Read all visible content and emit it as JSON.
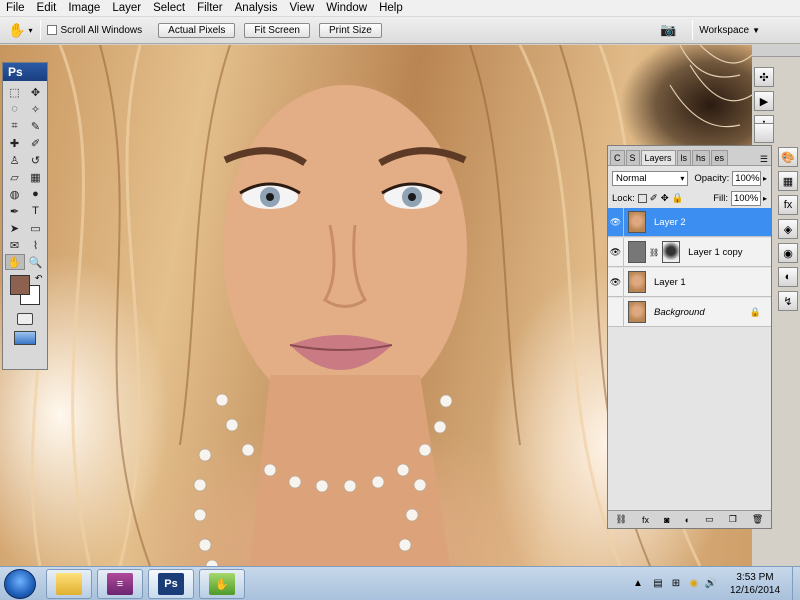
{
  "menu": [
    "File",
    "Edit",
    "Image",
    "Layer",
    "Select",
    "Filter",
    "Analysis",
    "View",
    "Window",
    "Help"
  ],
  "options": {
    "scroll_all": "Scroll All Windows",
    "actual_pixels": "Actual Pixels",
    "fit_screen": "Fit Screen",
    "print_size": "Print Size",
    "workspace": "Workspace"
  },
  "tools": {
    "logo": "Ps"
  },
  "layers_panel": {
    "tabs": [
      "C",
      "S",
      "Layers",
      "ls",
      "hs",
      "es"
    ],
    "active_tab": "Layers",
    "blend_mode": "Normal",
    "opacity_label": "Opacity:",
    "opacity_value": "100%",
    "lock_label": "Lock:",
    "fill_label": "Fill:",
    "fill_value": "100%",
    "layers": [
      {
        "name": "Layer 2",
        "active": true
      },
      {
        "name": "Layer 1 copy",
        "active": false
      },
      {
        "name": "Layer 1",
        "active": false
      },
      {
        "name": "Background",
        "active": false
      }
    ]
  },
  "taskbar": {
    "ps_label": "Ps",
    "time": "3:53 PM",
    "date": "12/16/2014"
  },
  "colors": {
    "foreground": "#8c6150",
    "background": "#ffffff",
    "selection": "#3c8ef0"
  }
}
